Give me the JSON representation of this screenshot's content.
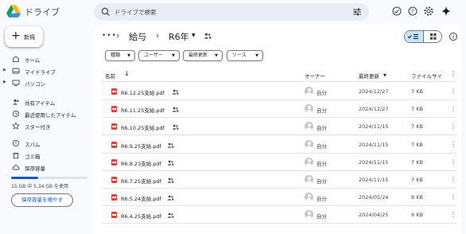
{
  "app": {
    "title": "ドライブ",
    "logo_icon": "google-drive-logo"
  },
  "search": {
    "placeholder": "ドライブで検索"
  },
  "sidebar": {
    "new_label": "新規",
    "items": [
      {
        "label": "ホーム",
        "icon": "home-icon",
        "expand": false
      },
      {
        "label": "マイドライブ",
        "icon": "my-drive-icon",
        "expand": true
      },
      {
        "label": "パソコン",
        "icon": "computer-icon",
        "expand": true
      },
      {
        "label": "共有アイテム",
        "icon": "shared-icon",
        "expand": false
      },
      {
        "label": "最近使用したアイテム",
        "icon": "recent-icon",
        "expand": false
      },
      {
        "label": "スター付き",
        "icon": "star-icon",
        "expand": false
      },
      {
        "label": "スパム",
        "icon": "spam-icon",
        "expand": false
      },
      {
        "label": "ゴミ箱",
        "icon": "trash-icon",
        "expand": false
      },
      {
        "label": "保存容量",
        "icon": "cloud-icon",
        "expand": false
      }
    ],
    "storage_text": "15 GB 中 5.34 GB を使用",
    "storage_used_fraction": 0.356,
    "get_storage_label": "保存容量を増やす"
  },
  "breadcrumb": {
    "more": "•••",
    "folder1": "給与",
    "folder2": "R6年"
  },
  "filters": [
    "種類",
    "ユーザー",
    "最終更新",
    "ソース"
  ],
  "columns": {
    "name": "名前",
    "owner": "オーナー",
    "modified": "最終更新",
    "size": "ファイルサイ"
  },
  "files": [
    {
      "name": "R6.12.25支給.pdf",
      "owner": "自分",
      "modified": "2024/12/27",
      "size": "7 KB"
    },
    {
      "name": "R6.11.25支給.pdf",
      "owner": "自分",
      "modified": "2024/12/27",
      "size": "7 KB"
    },
    {
      "name": "R6.10.25支給.pdf",
      "owner": "自分",
      "modified": "2024/11/15",
      "size": "7 KB"
    },
    {
      "name": "R6.9.25支給.pdf",
      "owner": "自分",
      "modified": "2024/11/15",
      "size": "7 KB"
    },
    {
      "name": "R6.8.23支給.pdf",
      "owner": "自分",
      "modified": "2024/11/15",
      "size": "7 KB"
    },
    {
      "name": "R6.7.25支給.pdf",
      "owner": "自分",
      "modified": "2024/11/15",
      "size": "7 KB"
    },
    {
      "name": "R6.5.24支給.pdf",
      "owner": "自分",
      "modified": "2024/05/24",
      "size": "8 KB"
    },
    {
      "name": "R6.4.25支給.pdf",
      "owner": "自分",
      "modified": "2024/04/25",
      "size": "8 KB"
    }
  ],
  "colors": {
    "accent": "#0b57d0",
    "pdf_red": "#ea4335",
    "selected_toggle": "#c2e7ff"
  }
}
